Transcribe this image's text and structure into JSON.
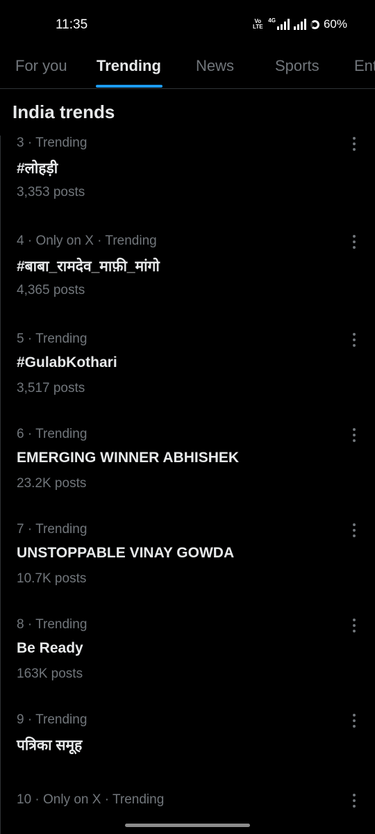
{
  "status_bar": {
    "time": "11:35",
    "volte_label": "Vo\nLTE",
    "network_type": "4G",
    "battery": "60%"
  },
  "tabs": [
    {
      "label": "For you"
    },
    {
      "label": "Trending"
    },
    {
      "label": "News"
    },
    {
      "label": "Sports"
    },
    {
      "label": "Ent"
    }
  ],
  "active_tab": "Trending",
  "colors": {
    "accent": "#1d9bf0",
    "background": "#000000",
    "primary_text": "#e7e9ea",
    "secondary_text": "#71767b"
  },
  "section_title": "India trends",
  "trends": [
    {
      "meta": "3 · Trending",
      "name": "#लोहड़ी",
      "posts": "3,353 posts"
    },
    {
      "meta": "4 · Only on X · Trending",
      "name": "#बाबा_रामदेव_माफ़ी_मांगो",
      "posts": "4,365 posts"
    },
    {
      "meta": "5 · Trending",
      "name": "#GulabKothari",
      "posts": "3,517 posts"
    },
    {
      "meta": "6 · Trending",
      "name": "EMERGING WINNER ABHISHEK",
      "posts": "23.2K posts"
    },
    {
      "meta": "7 · Trending",
      "name": "UNSTOPPABLE VINAY GOWDA",
      "posts": "10.7K posts"
    },
    {
      "meta": "8 · Trending",
      "name": "Be Ready",
      "posts": "163K posts"
    },
    {
      "meta": "9 · Trending",
      "name": "पत्रिका समूह",
      "posts": ""
    },
    {
      "meta": "10 · Only on X · Trending",
      "name": "",
      "posts": ""
    }
  ],
  "icons": {
    "more": "more-vertical-icon",
    "battery": "battery-ring-icon",
    "signal": "signal-bars-icon"
  }
}
